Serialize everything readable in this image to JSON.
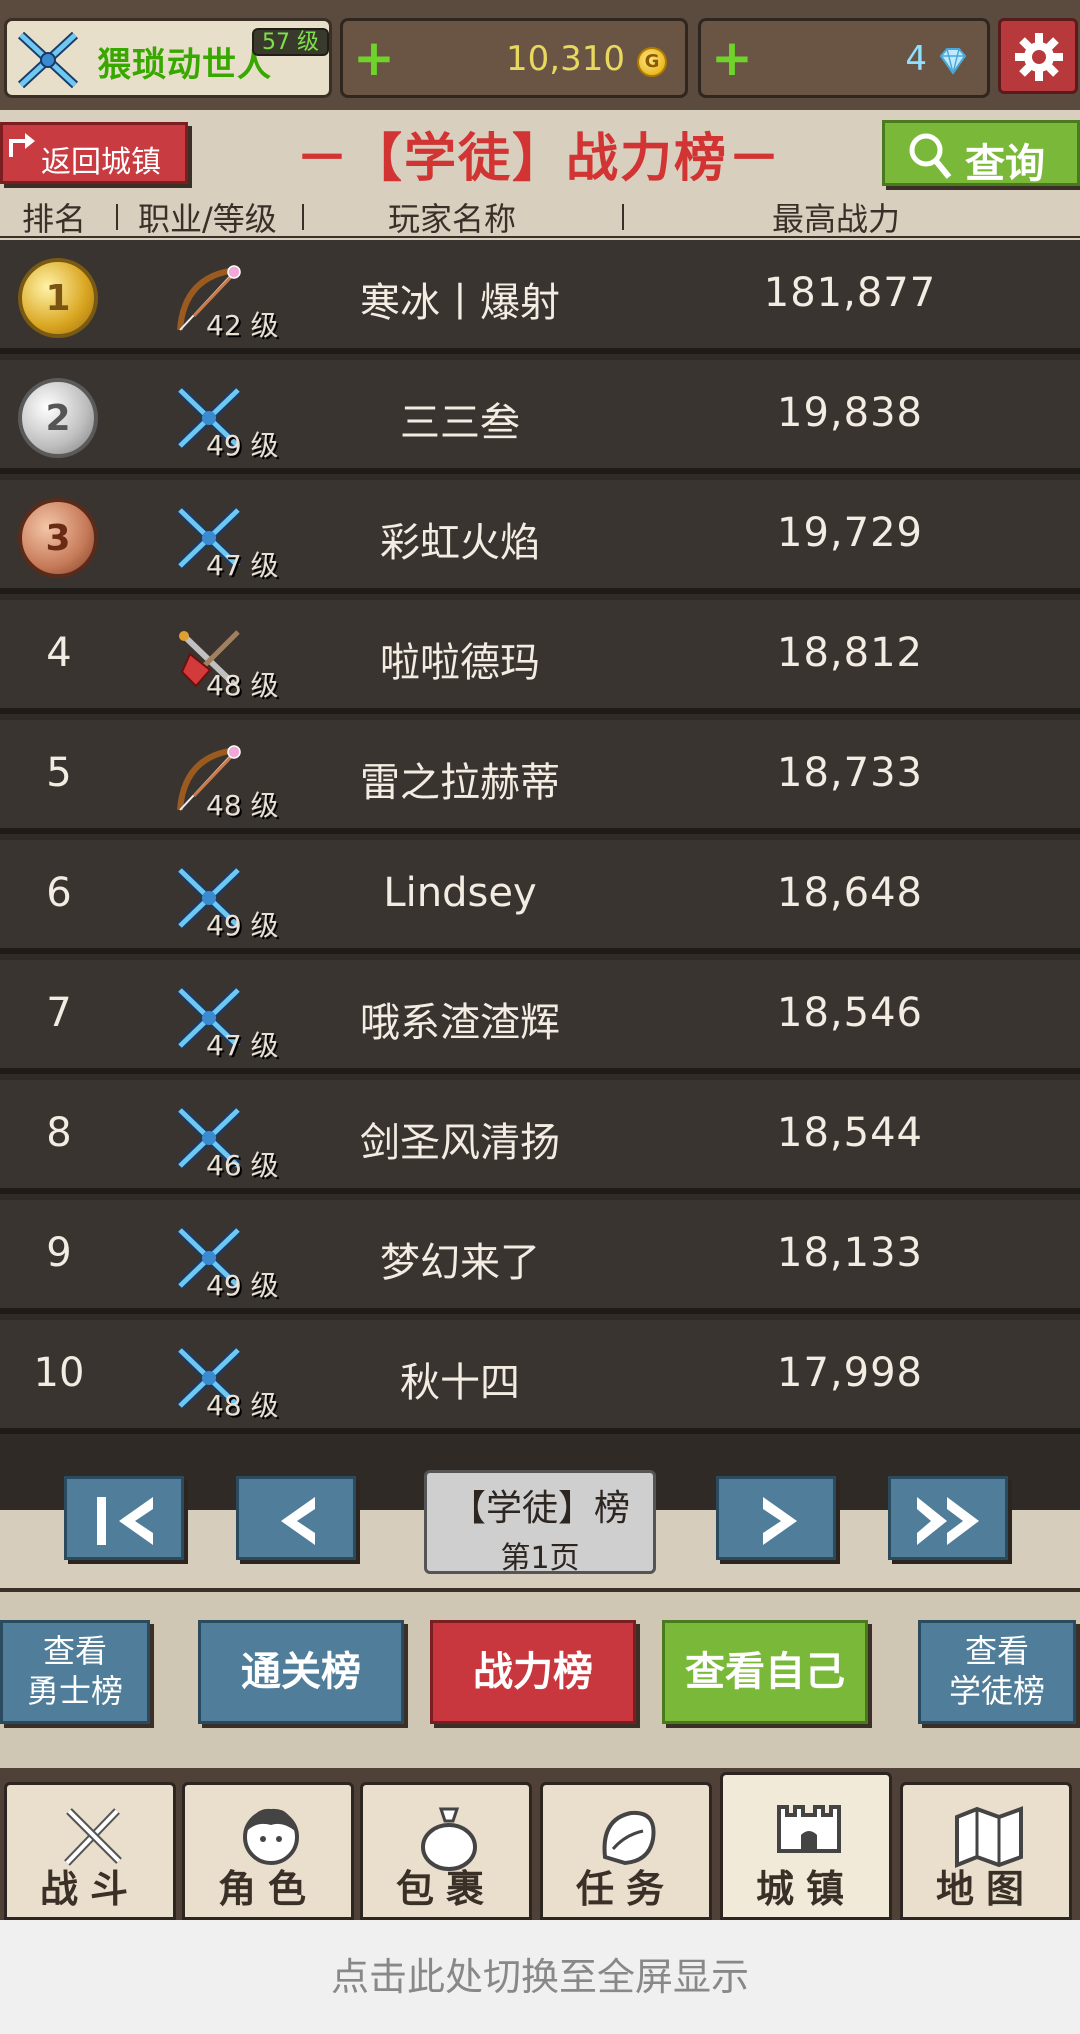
{
  "player": {
    "name": "猥琐动世人",
    "level": "57 级"
  },
  "resources": {
    "gold": "10,310",
    "gems": "4"
  },
  "title_row": {
    "back_label": "返回城镇",
    "title": "－【学徒】战力榜－",
    "search_label": "查询"
  },
  "columns": {
    "rank": "排名",
    "class": "职业/等级",
    "name": "玩家名称",
    "power": "最高战力"
  },
  "rows": [
    {
      "rank": "1",
      "class_icon": "bow-icon",
      "level": "42 级",
      "name": "寒冰丨爆射",
      "power": "181,877"
    },
    {
      "rank": "2",
      "class_icon": "crossed-swords-icon",
      "level": "49 级",
      "name": "三三叁",
      "power": "19,838"
    },
    {
      "rank": "3",
      "class_icon": "crossed-swords-icon",
      "level": "47 级",
      "name": "彩虹火焰",
      "power": "19,729"
    },
    {
      "rank": "4",
      "class_icon": "daggers-icon",
      "level": "48 级",
      "name": "啦啦德玛",
      "power": "18,812"
    },
    {
      "rank": "5",
      "class_icon": "bow-icon",
      "level": "48 级",
      "name": "雷之拉赫蒂",
      "power": "18,733"
    },
    {
      "rank": "6",
      "class_icon": "crossed-swords-icon",
      "level": "49 级",
      "name": "Lindsey",
      "power": "18,648"
    },
    {
      "rank": "7",
      "class_icon": "crossed-swords-icon",
      "level": "47 级",
      "name": "哦系渣渣辉",
      "power": "18,546"
    },
    {
      "rank": "8",
      "class_icon": "crossed-swords-icon",
      "level": "46 级",
      "name": "剑圣风清扬",
      "power": "18,544"
    },
    {
      "rank": "9",
      "class_icon": "crossed-swords-icon",
      "level": "49 级",
      "name": "梦幻来了",
      "power": "18,133"
    },
    {
      "rank": "10",
      "class_icon": "crossed-swords-icon",
      "level": "48 级",
      "name": "秋十四",
      "power": "17,998"
    }
  ],
  "pager": {
    "board": "【学徒】榜",
    "page": "第1页"
  },
  "boards": {
    "warrior": "查看 勇士榜",
    "warrior_l1": "查看",
    "warrior_l2": "勇士榜",
    "clear": "通关榜",
    "power": "战力榜",
    "self": "查看自己",
    "apprentice_l1": "查看",
    "apprentice_l2": "学徒榜"
  },
  "nav": [
    {
      "label": "战斗",
      "icon": "sword-icon"
    },
    {
      "label": "角色",
      "icon": "character-icon"
    },
    {
      "label": "包裹",
      "icon": "bag-icon"
    },
    {
      "label": "任务",
      "icon": "quest-icon"
    },
    {
      "label": "城镇",
      "icon": "castle-icon"
    },
    {
      "label": "地图",
      "icon": "map-icon"
    }
  ],
  "fullscreen_hint": "点击此处切换至全屏显示"
}
